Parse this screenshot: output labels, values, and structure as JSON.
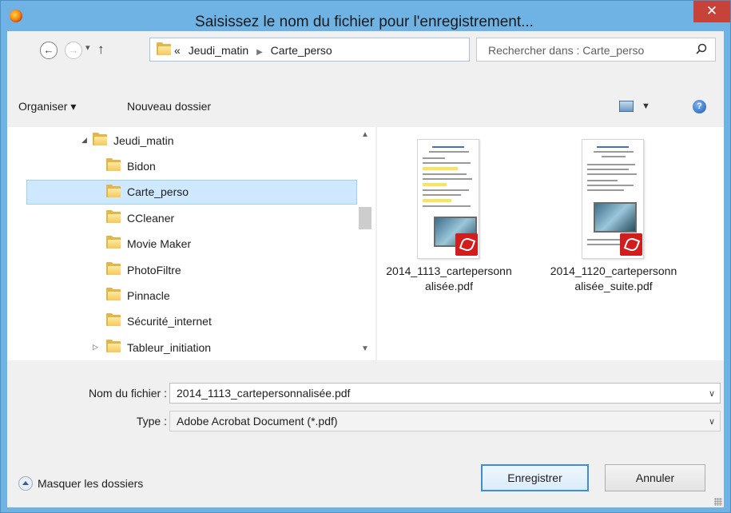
{
  "window": {
    "title": "Saisissez le nom du fichier pour l'enregistrement...",
    "close_label": "✕"
  },
  "address": {
    "overflow": "«",
    "crumbs": [
      "Jeudi_matin",
      "Carte_perso"
    ]
  },
  "search": {
    "placeholder": "Rechercher dans : Carte_perso"
  },
  "toolbar": {
    "organize_label": "Organiser ▾",
    "new_folder_label": "Nouveau dossier"
  },
  "tree": {
    "items": [
      {
        "label": "Jeudi_matin",
        "expander": "◢"
      },
      {
        "label": "Bidon"
      },
      {
        "label": "Carte_perso"
      },
      {
        "label": "CCleaner"
      },
      {
        "label": "Movie Maker"
      },
      {
        "label": "PhotoFiltre"
      },
      {
        "label": "Pinnacle"
      },
      {
        "label": "Sécurité_internet"
      },
      {
        "label": "Tableur_initiation",
        "expander": "▷"
      }
    ]
  },
  "files": [
    {
      "name": "2014_1113_cartepersonnalisée.pdf",
      "icon": "pdf-icon"
    },
    {
      "name": "2014_1120_cartepersonnalisée_suite.pdf",
      "icon": "pdf-icon"
    }
  ],
  "form": {
    "filename_label": "Nom du fichier :",
    "filename_value": "2014_1113_cartepersonnalisée.pdf",
    "type_label": "Type :",
    "type_value": "Adobe Acrobat Document (*.pdf)"
  },
  "footer": {
    "hide_folders_label": "Masquer les dossiers",
    "save_label": "Enregistrer",
    "cancel_label": "Annuler"
  }
}
